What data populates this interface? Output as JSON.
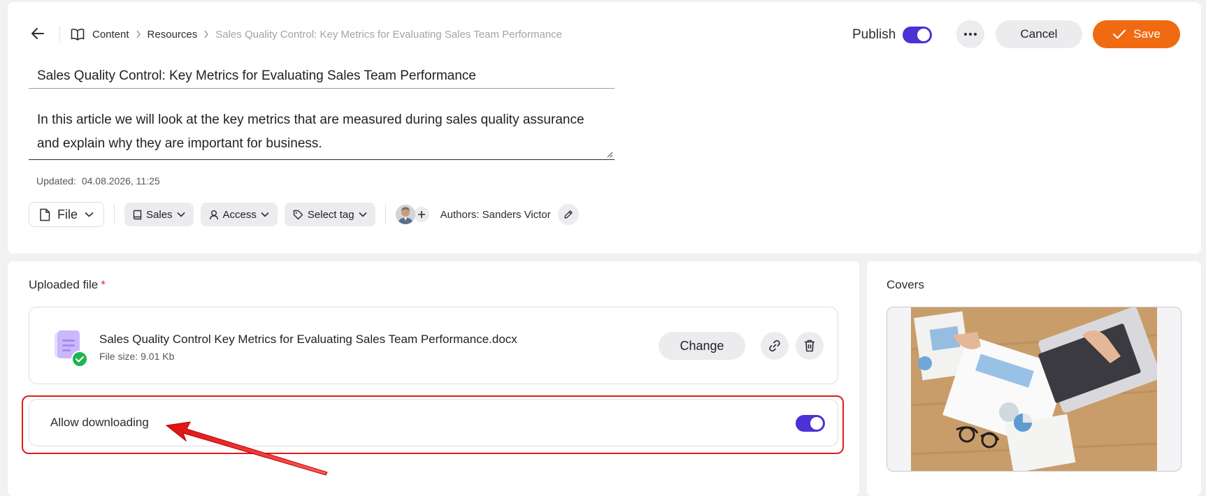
{
  "breadcrumb": {
    "items": [
      "Content",
      "Resources"
    ],
    "current": "Sales Quality Control: Key Metrics for Evaluating Sales Team Performance"
  },
  "header": {
    "publish_label": "Publish",
    "publish_on": true,
    "cancel_label": "Cancel",
    "save_label": "Save"
  },
  "article": {
    "title": "Sales Quality Control: Key Metrics for Evaluating Sales Team Performance",
    "description": "In this article we will look at the key metrics that are measured during sales quality assurance and explain why they are important for business.",
    "updated_label": "Updated:",
    "updated_value": "04.08.2026, 11:25"
  },
  "meta": {
    "type_label": "File",
    "category_label": "Sales",
    "access_label": "Access",
    "tag_label": "Select tag",
    "authors_text": "Authors: Sanders Victor"
  },
  "uploaded_file": {
    "section_title": "Uploaded file",
    "required_mark": "*",
    "file_name": "Sales Quality Control Key Metrics for Evaluating Sales Team Performance.docx",
    "file_size": "File size: 9.01 Kb",
    "change_label": "Change",
    "allow_downloading_label": "Allow downloading",
    "allow_downloading_on": true
  },
  "covers": {
    "section_title": "Covers"
  },
  "colors": {
    "accent": "#4a32d6",
    "save": "#f06a12",
    "highlight": "#e21b1b",
    "success": "#1fb551"
  },
  "icons": {
    "back": "arrow-left-icon",
    "book": "book-icon",
    "more": "more-horizontal-icon",
    "check": "check-icon",
    "file": "file-icon",
    "chevron": "chevron-down-icon",
    "tag": "tag-icon",
    "user": "user-icon",
    "plus": "plus-icon",
    "pencil": "pencil-icon",
    "link": "link-icon",
    "trash": "trash-icon",
    "document": "document-icon"
  }
}
